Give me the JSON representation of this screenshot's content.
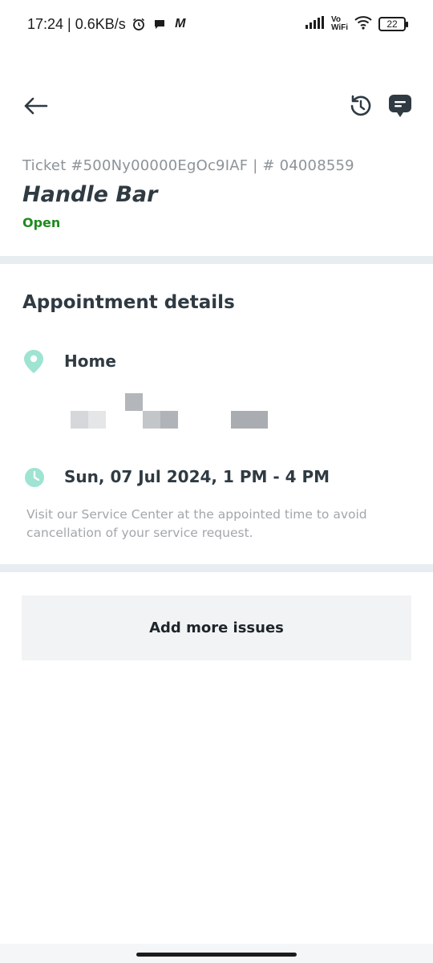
{
  "status_bar": {
    "time_speed": "17:24 | 0.6KB/s",
    "alarm_icon": "alarm-icon",
    "chat_bubble_icon": "chat-bubble-icon",
    "m_icon": "M",
    "vo": "Vo",
    "wifi_label": "WiFi",
    "battery": "22"
  },
  "header": {
    "back_icon": "arrow-left-icon",
    "refresh_icon": "refresh-icon",
    "chat_icon": "message-icon"
  },
  "ticket": {
    "id_line": "Ticket #500Ny00000EgOc9IAF | # 04008559",
    "title": "Handle Bar",
    "status": "Open"
  },
  "appointment": {
    "heading": "Appointment details",
    "location_label": "Home",
    "time": "Sun, 07 Jul 2024, 1 PM - 4 PM",
    "note": "Visit our Service Center at the appointed time to avoid cancellation of your service request."
  },
  "actions": {
    "add_issues_label": "Add more issues"
  },
  "colors": {
    "accent_mint": "#9fe3d2",
    "status_green": "#1f8a1f",
    "divider": "#e8edf1"
  }
}
